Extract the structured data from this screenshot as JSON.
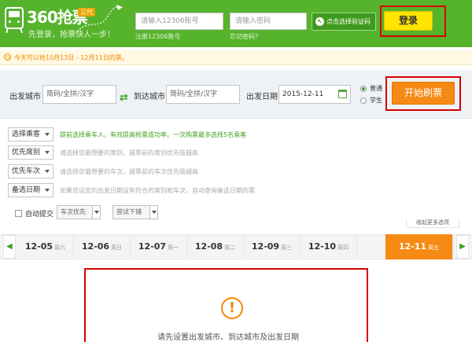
{
  "app": {
    "brand": "360抢票",
    "badge": "三代",
    "slogan": "先登录，抢票快人一步！"
  },
  "login": {
    "account_placeholder": "请输入12306账号",
    "account_hint": "注册12306账号",
    "password_placeholder": "请输入密码",
    "password_hint": "忘记密码?",
    "captcha_label": "点击选择验证码",
    "login_label": "登录"
  },
  "notice": {
    "text": "今天可以抢10月13日 - 12月11日的票。"
  },
  "search": {
    "from_label": "出发城市",
    "from_placeholder": "简码/全拼/汉字",
    "to_label": "到达城市",
    "to_placeholder": "简码/全拼/汉字",
    "date_label": "出发日期",
    "date_value": "2015-12-11",
    "ticket_types": [
      "普通",
      "学生"
    ],
    "selected_type": "普通",
    "start_label": "开始刷票"
  },
  "options": [
    {
      "label": "选择乘客",
      "text": "提前选择乘车人，有效提高抢票成功率。一次购票最多选择5名乘客",
      "style": "green"
    },
    {
      "label": "优先席别",
      "text": "请选择您最想要的席别，越靠前的席别优先级越高",
      "style": "gray"
    },
    {
      "label": "优先车次",
      "text": "请选择您最想要的车次，越靠前的车次优先级越高",
      "style": "gray"
    },
    {
      "label": "备选日期",
      "text": "如果您设定的出发日期没有符合的席别和车次，自动查询备选日期的票",
      "style": "gray"
    }
  ],
  "auto_submit": {
    "label": "自动提交",
    "mode": "车次优先",
    "berth": "尝试下铺",
    "more_options": "收起更多选项"
  },
  "dates": [
    {
      "date": "12-05",
      "weekday": "周六",
      "active": false
    },
    {
      "date": "12-06",
      "weekday": "周日",
      "active": false
    },
    {
      "date": "12-07",
      "weekday": "周一",
      "active": false
    },
    {
      "date": "12-08",
      "weekday": "周二",
      "active": false
    },
    {
      "date": "12-09",
      "weekday": "周三",
      "active": false
    },
    {
      "date": "12-10",
      "weekday": "周四",
      "active": false
    },
    {
      "date": "12-11",
      "weekday": "周五",
      "active": true
    }
  ],
  "message": {
    "icon": "!",
    "text": "请先设置出发城市、到达城市及出发日期"
  },
  "colors": {
    "brand_green": "#56b32c",
    "accent_orange": "#f58a14",
    "login_yellow": "#ffe500",
    "highlight_red": "#d80000"
  }
}
